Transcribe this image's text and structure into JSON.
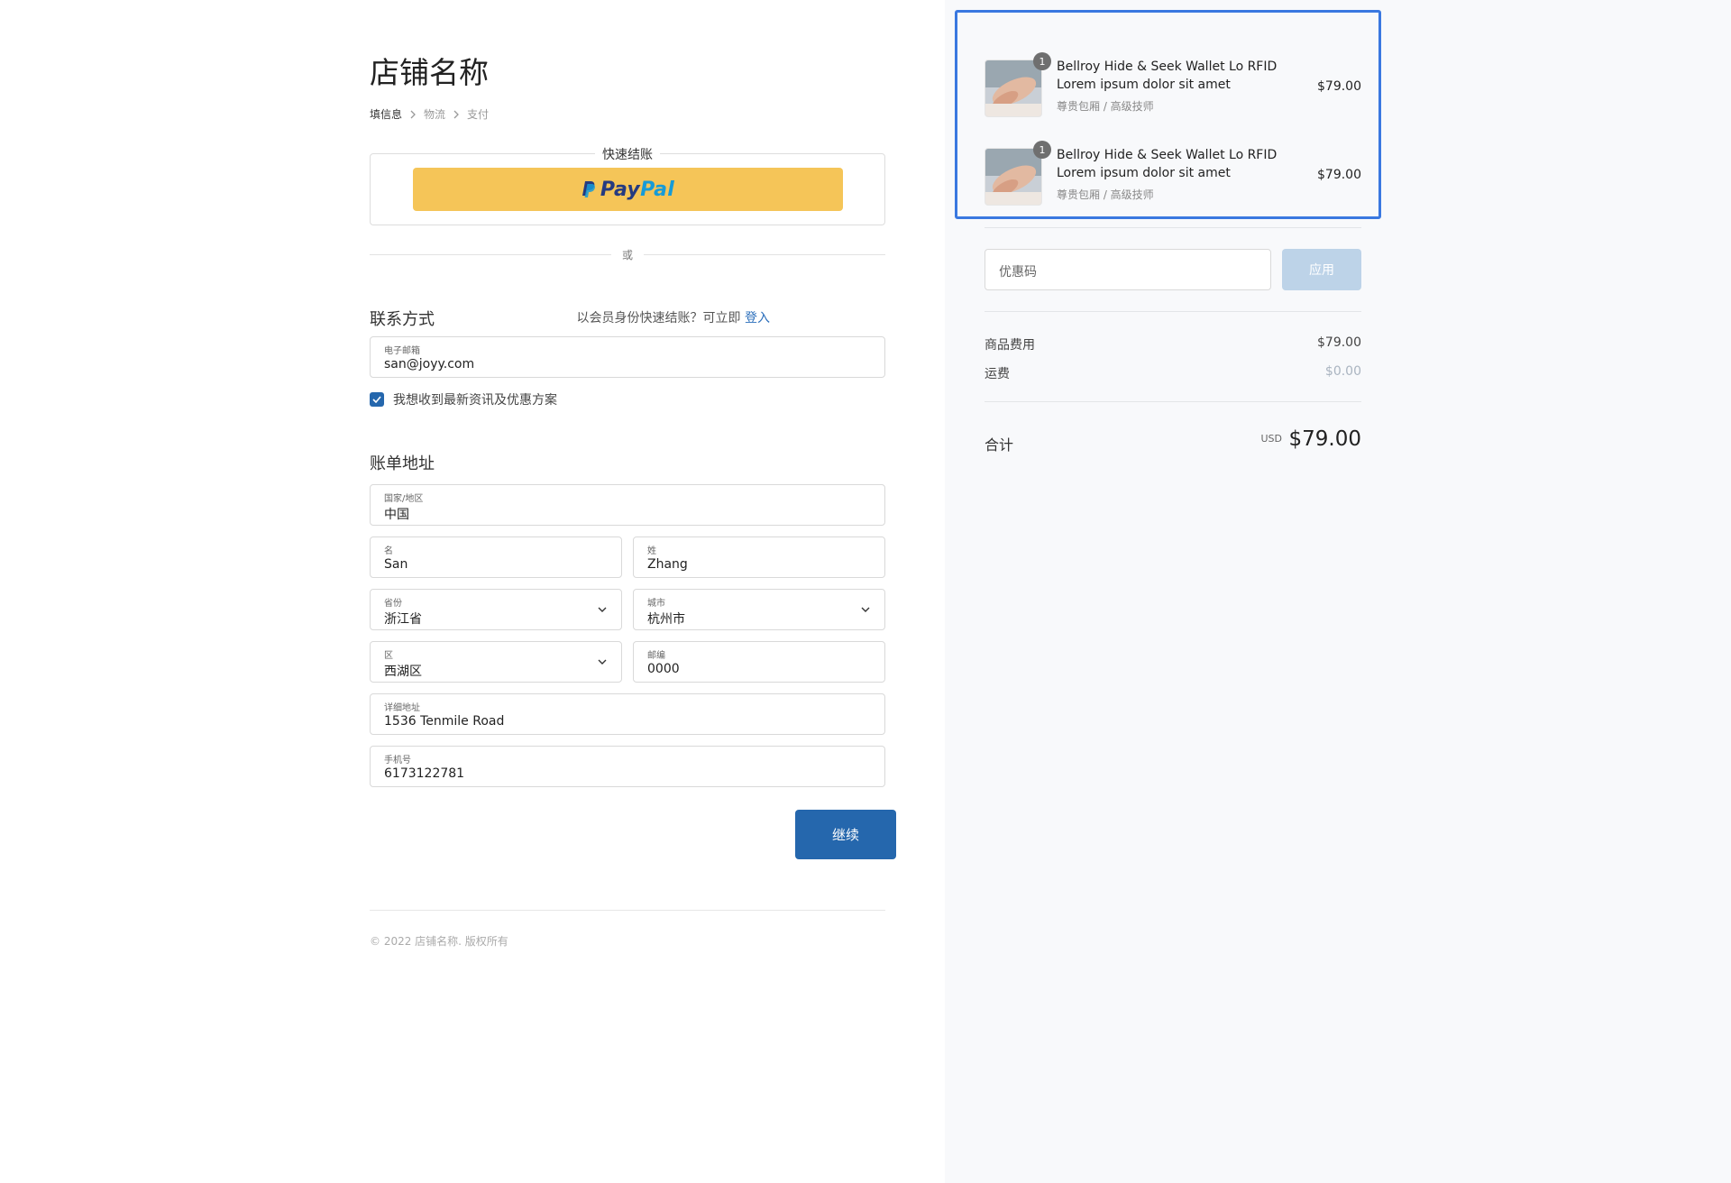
{
  "store": {
    "name": "店铺名称"
  },
  "breadcrumb": {
    "step1": "填信息",
    "step2": "物流",
    "step3": "支付"
  },
  "express": {
    "title": "快速结账",
    "paypal_pay": "Pay",
    "paypal_pal": "Pal"
  },
  "divider_or": "或",
  "contact": {
    "title": "联系方式",
    "member_prompt": "以会员身份快速结账？可立即",
    "login_link": "登入",
    "email_label": "电子邮箱",
    "email_value": "san@joyy.com",
    "newsletter_label": "我想收到最新资讯及优惠方案",
    "newsletter_checked": true
  },
  "billing": {
    "title": "账单地址",
    "country_label": "国家/地区",
    "country_value": "中国",
    "first_name_label": "名",
    "first_name_value": "San",
    "last_name_label": "姓",
    "last_name_value": "Zhang",
    "province_label": "省份",
    "province_value": "浙江省",
    "city_label": "城市",
    "city_value": "杭州市",
    "district_label": "区",
    "district_value": "西湖区",
    "zip_label": "邮编",
    "zip_value": "0000",
    "address_label": "详细地址",
    "address_value": "1536 Tenmile Road",
    "phone_label": "手机号",
    "phone_value": "6173122781"
  },
  "continue_label": "继续",
  "footer": "© 2022 店铺名称. 版权所有",
  "cart": {
    "items": [
      {
        "qty": "1",
        "name": "Bellroy Hide & Seek Wallet Lo RFID Lorem ipsum dolor sit amet",
        "variant": "尊贵包厢 / 高级技师",
        "price": "$79.00"
      },
      {
        "qty": "1",
        "name": "Bellroy Hide & Seek Wallet Lo RFID Lorem ipsum dolor sit amet",
        "variant": "尊贵包厢 / 高级技师",
        "price": "$79.00"
      }
    ]
  },
  "coupon": {
    "placeholder": "优惠码",
    "apply_label": "应用"
  },
  "summary": {
    "subtotal_label": "商品费用",
    "subtotal_value": "$79.00",
    "shipping_label": "运费",
    "shipping_value": "$0.00",
    "total_label": "合计",
    "currency": "USD",
    "total_value": "$79.00"
  },
  "colors": {
    "primary": "#2567ad",
    "paypal_bg": "#f5c558",
    "highlight_border": "#3a78e0"
  }
}
